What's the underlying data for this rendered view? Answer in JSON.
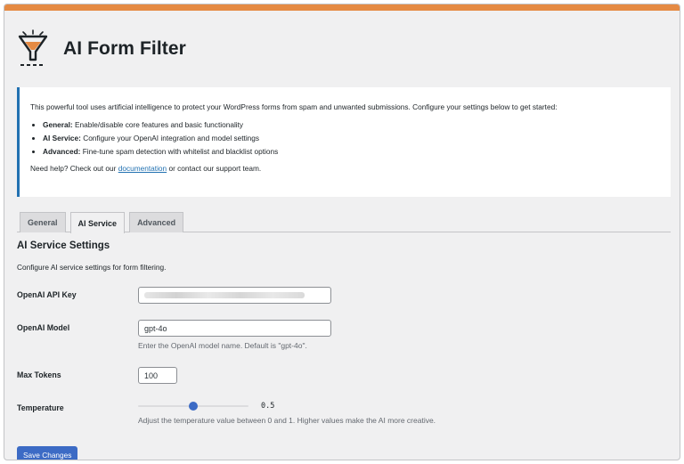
{
  "app": {
    "title": "AI Form Filter"
  },
  "colors": {
    "accent_bar": "#e58a43",
    "primary": "#3c6bc5",
    "notice_border": "#2271b1"
  },
  "notice": {
    "intro": "This powerful tool uses artificial intelligence to protect your WordPress forms from spam and unwanted submissions. Configure your settings below to get started:",
    "items": [
      {
        "label": "General:",
        "text": " Enable/disable core features and basic functionality"
      },
      {
        "label": "AI Service:",
        "text": " Configure your OpenAI integration and model settings"
      },
      {
        "label": "Advanced:",
        "text": " Fine-tune spam detection with whitelist and blacklist options"
      }
    ],
    "help_prefix": "Need help? Check out our ",
    "help_link": "documentation",
    "help_suffix": " or contact our support team."
  },
  "tabs": [
    {
      "label": "General",
      "active": false
    },
    {
      "label": "AI Service",
      "active": true
    },
    {
      "label": "Advanced",
      "active": false
    }
  ],
  "section": {
    "title": "AI Service Settings",
    "description": "Configure AI service settings for form filtering."
  },
  "fields": {
    "api_key": {
      "label": "OpenAI API Key",
      "value_hidden": true
    },
    "model": {
      "label": "OpenAI Model",
      "value": "gpt-4o",
      "help": "Enter the OpenAI model name. Default is \"gpt-4o\"."
    },
    "max_tokens": {
      "label": "Max Tokens",
      "value": "100"
    },
    "temperature": {
      "label": "Temperature",
      "value": "0.5",
      "fraction": 0.5,
      "help": "Adjust the temperature value between 0 and 1. Higher values make the AI more creative."
    }
  },
  "buttons": {
    "save": "Save Changes"
  }
}
